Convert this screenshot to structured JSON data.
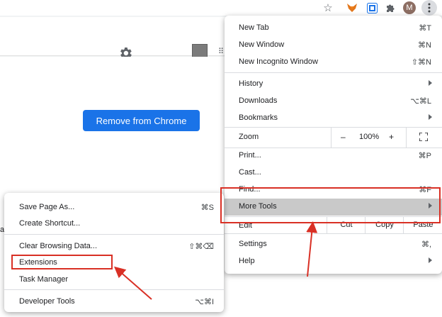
{
  "toolbar": {
    "icons": [
      "star-icon",
      "metamask-fox-icon",
      "extension-icon",
      "puzzle-icon",
      "avatar",
      "kebab-menu-icon"
    ],
    "avatar_initial": "M"
  },
  "page": {
    "remove_button": "Remove from Chrome",
    "side_letter": "a"
  },
  "menu": {
    "new_tab": {
      "label": "New Tab",
      "shortcut": "⌘T"
    },
    "new_window": {
      "label": "New Window",
      "shortcut": "⌘N"
    },
    "new_incognito": {
      "label": "New Incognito Window",
      "shortcut": "⇧⌘N"
    },
    "history": {
      "label": "History"
    },
    "downloads": {
      "label": "Downloads",
      "shortcut": "⌥⌘L"
    },
    "bookmarks": {
      "label": "Bookmarks"
    },
    "zoom": {
      "label": "Zoom",
      "minus": "–",
      "value": "100%",
      "plus": "+"
    },
    "print": {
      "label": "Print...",
      "shortcut": "⌘P"
    },
    "cast": {
      "label": "Cast..."
    },
    "find": {
      "label": "Find...",
      "shortcut": "⌘F"
    },
    "more_tools": {
      "label": "More Tools"
    },
    "edit": {
      "label": "Edit",
      "cut": "Cut",
      "copy": "Copy",
      "paste": "Paste"
    },
    "settings": {
      "label": "Settings",
      "shortcut": "⌘,"
    },
    "help": {
      "label": "Help"
    }
  },
  "submenu": {
    "save_page": {
      "label": "Save Page As...",
      "shortcut": "⌘S"
    },
    "create_shortcut": {
      "label": "Create Shortcut..."
    },
    "clear_data": {
      "label": "Clear Browsing Data...",
      "shortcut": "⇧⌘⌫"
    },
    "extensions": {
      "label": "Extensions"
    },
    "task_manager": {
      "label": "Task Manager"
    },
    "developer_tools": {
      "label": "Developer Tools",
      "shortcut": "⌥⌘I"
    }
  },
  "colors": {
    "highlight": "#d93025",
    "accent": "#1a73e8",
    "hover_row": "#c9c9c9"
  }
}
